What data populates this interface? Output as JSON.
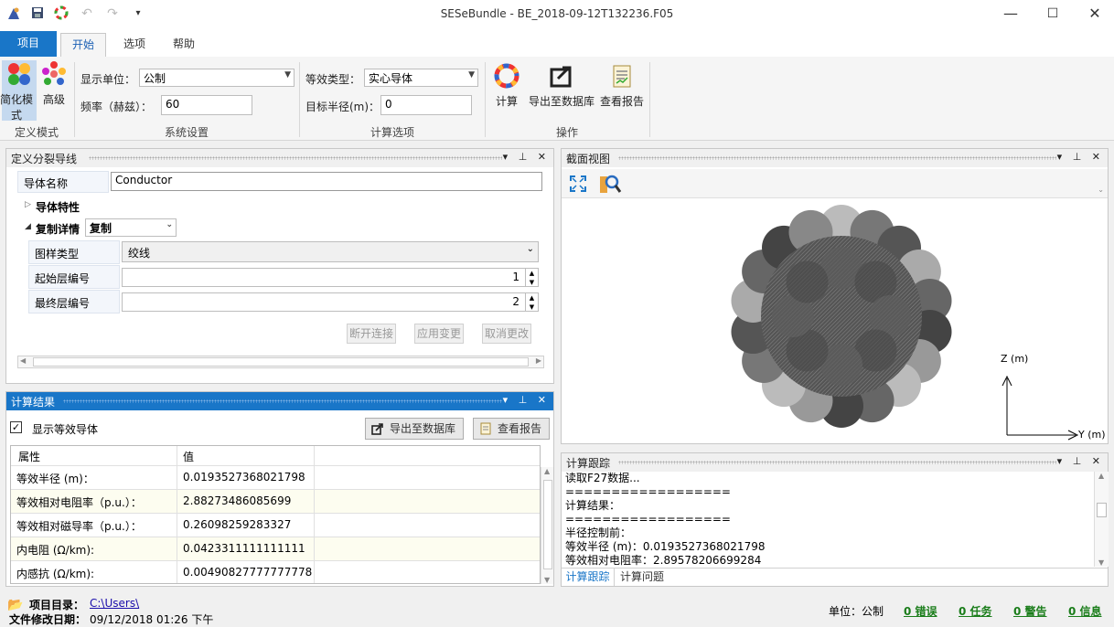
{
  "window": {
    "title": "SESeBundle - BE_2018-09-12T132236.F05"
  },
  "ribbon_tabs": [
    {
      "label": "项目"
    },
    {
      "label": "开始"
    },
    {
      "label": "选项"
    },
    {
      "label": "帮助"
    }
  ],
  "ribbon": {
    "mode_group": {
      "label": "定义模式",
      "simple": "简化模式",
      "advanced": "高级"
    },
    "system_group": {
      "label": "系统设置",
      "unit_label": "显示单位：",
      "unit_value": "公制",
      "freq_label": "频率（赫兹）：",
      "freq_value": "60"
    },
    "calc_group": {
      "label": "计算选项",
      "equiv_type_label": "等效类型：",
      "equiv_type_value": "实心导体",
      "target_radius_label": "目标半径(m)：",
      "target_radius_value": "0"
    },
    "ops_group": {
      "label": "操作",
      "calc": "计算",
      "export": "导出至数据库",
      "report": "查看报告"
    }
  },
  "define_panel": {
    "title": "定义分裂导线",
    "conductor_name_label": "导体名称",
    "conductor_name_value": "Conductor",
    "properties_label": "导体特性",
    "copy_detail_label": "复制详情",
    "copy_value": "复制",
    "pattern_label": "图样类型",
    "pattern_value": "绞线",
    "start_layer_label": "起始层编号",
    "start_layer_value": "1",
    "end_layer_label": "最终层编号",
    "end_layer_value": "2",
    "disconnect": "断开连接",
    "apply": "应用变更",
    "cancel": "取消更改"
  },
  "results_panel": {
    "title": "计算结果",
    "show_equiv_label": "显示等效导体",
    "export": "导出至数据库",
    "report": "查看报告",
    "col_attr": "属性",
    "col_value": "值",
    "rows": [
      {
        "attr": "等效半径 (m)：",
        "value": "0.0193527368021798"
      },
      {
        "attr": "等效相对电阻率（p.u.）：",
        "value": "2.88273486085699"
      },
      {
        "attr": "等效相对磁导率（p.u.）：",
        "value": "0.26098259283327"
      },
      {
        "attr": "内电阻 (Ω/km):",
        "value": "0.0423311111111111"
      },
      {
        "attr": "内感抗 (Ω/km):",
        "value": "0.00490827777777778"
      }
    ]
  },
  "section_panel": {
    "title": "截面视图",
    "z_axis": "Z (m)",
    "y_axis": "Y (m)"
  },
  "trace_panel": {
    "title": "计算跟踪",
    "lines": [
      "读取F27数据...",
      "==================",
      "计算结果：",
      "==================",
      "半径控制前：",
      "等效半径 (m)：0.0193527368021798",
      "等效相对电阻率：2.89578206699284"
    ],
    "tab_trace": "计算跟踪",
    "tab_issues": "计算问题"
  },
  "status": {
    "project_dir_label": "项目目录：",
    "project_dir_value": "C:\\Users\\",
    "modified_label": "文件修改日期：",
    "modified_value": "09/12/2018 01:26 下午",
    "unit": "单位：公制",
    "errors": "0 错误",
    "tasks": "0 任务",
    "warnings": "0 警告",
    "info": "0 信息"
  },
  "colors": {
    "accent": "#1976c8",
    "link": "#1a0dab",
    "status_green": "#1a7d1a"
  }
}
